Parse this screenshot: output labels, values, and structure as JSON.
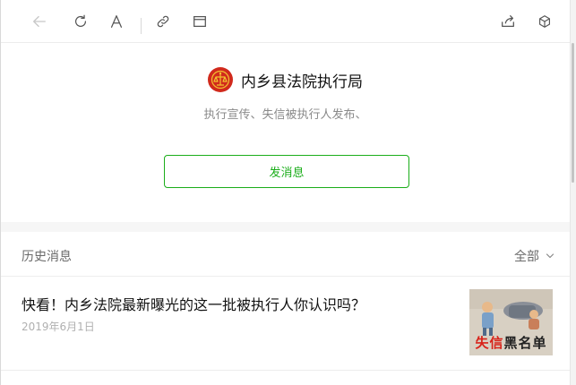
{
  "toolbar": {
    "icons": [
      "back-arrow-icon",
      "refresh-icon",
      "font-size-icon",
      "copy-link-icon",
      "open-in-browser-icon",
      "share-icon",
      "mini-program-icon"
    ]
  },
  "account": {
    "name": "内乡县法院执行局",
    "description": "执行宣传、失信被执行人发布、",
    "send_button": "发消息"
  },
  "history": {
    "title": "历史消息",
    "filter_label": "全部",
    "articles": [
      {
        "title": "快看！内乡法院最新曝光的这一批被执行人你认识吗？",
        "date": "2019年6月1日",
        "thumbnail_text_red": "失信",
        "thumbnail_text_dark": "黑名单"
      }
    ]
  },
  "colors": {
    "accent": "#1aad19",
    "avatar_bg": "#d12a1c",
    "thumb_red": "#d8231a"
  }
}
